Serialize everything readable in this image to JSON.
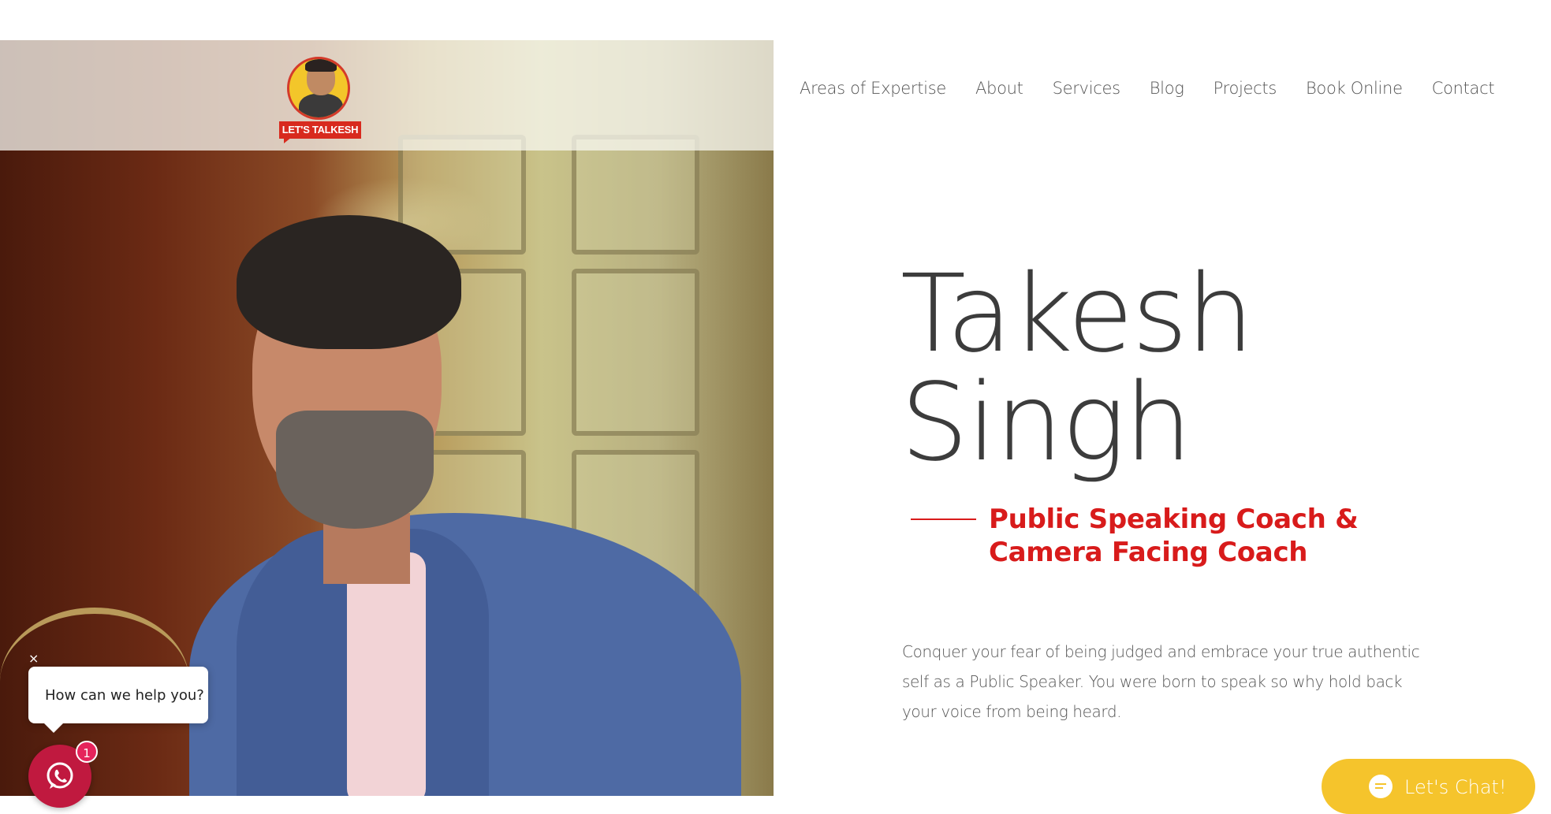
{
  "brand": {
    "logo_text": "LET'S TALKESH"
  },
  "nav": {
    "items": [
      {
        "label": "Areas of Expertise"
      },
      {
        "label": "About"
      },
      {
        "label": "Services"
      },
      {
        "label": "Blog"
      },
      {
        "label": "Projects"
      },
      {
        "label": "Book Online"
      },
      {
        "label": "Contact"
      }
    ]
  },
  "hero": {
    "name_line1": "Takesh",
    "name_line2": "Singh",
    "subtitle_line1": "Public Speaking Coach &",
    "subtitle_line2": "Camera Facing Coach",
    "description": "Conquer your fear of being judged and embrace your true authentic self as a Public Speaker. You were born to speak so why hold back your voice from being heard."
  },
  "whatsapp_widget": {
    "close_label": "×",
    "prompt": "How can we help you?",
    "badge_count": "1"
  },
  "chat_widget": {
    "label": "Let's Chat!"
  },
  "colors": {
    "accent_red": "#d81b1b",
    "nav_text": "#555555",
    "name_text": "#3c3c3c",
    "whatsapp_button": "#c0193f",
    "chat_widget": "#f5c42c"
  }
}
